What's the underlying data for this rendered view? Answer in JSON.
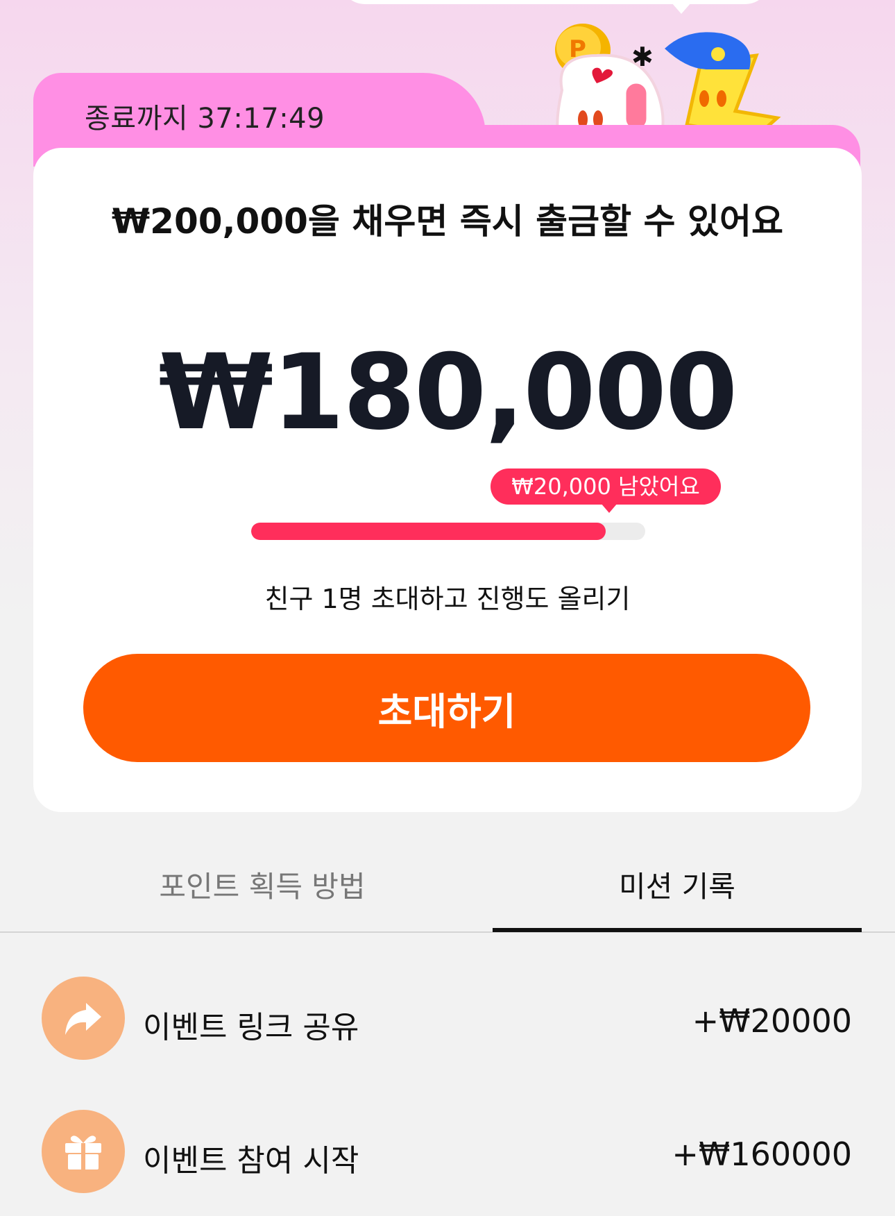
{
  "timer": {
    "label": "종료까지 37:17:49"
  },
  "card": {
    "headline": "₩200,000을 채우면 즉시 출금할 수 있어요",
    "amount": "₩180,000",
    "remaining_badge": "₩20,000 남았어요",
    "progress": 0.9,
    "hint": "친구 1명 초대하고 진행도 올리기",
    "invite_button": "초대하기"
  },
  "tabs": [
    {
      "label": "포인트 획득 방법",
      "active": false
    },
    {
      "label": "미션 기록",
      "active": true
    }
  ],
  "records": [
    {
      "icon": "share-arrow-icon",
      "label": "이벤트 링크 공유",
      "value": "+₩20000"
    },
    {
      "icon": "gift-icon",
      "label": "이벤트 참여 시작",
      "value": "+₩160000"
    }
  ],
  "colors": {
    "accent": "#ff5a00",
    "progress": "#ff2e5b",
    "timer_tab": "#ff8fe4",
    "record_icon_bg": "#f8b27f"
  }
}
